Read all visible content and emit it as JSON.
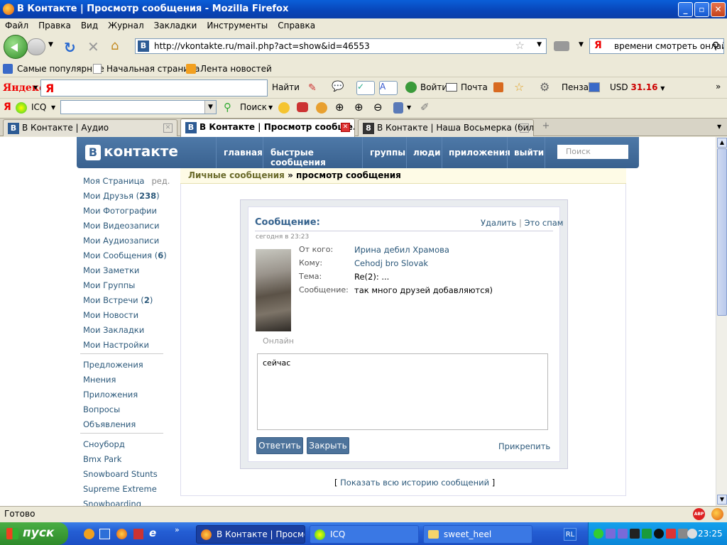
{
  "window": {
    "title": "В Контакте | Просмотр сообщения - Mozilla Firefox"
  },
  "menu": [
    "Файл",
    "Правка",
    "Вид",
    "Журнал",
    "Закладки",
    "Инструменты",
    "Справка"
  ],
  "url": "http://vkontakte.ru/mail.php?act=show&id=46553",
  "search_query": "времени смотреть онлайн",
  "bookmarks": [
    "Самые популярные",
    "Начальная страница",
    "Лента новостей"
  ],
  "yandex_bar": {
    "label": "Яндекс",
    "find": "Найти",
    "login": "Войти",
    "mail": "Почта",
    "city": "Пенза",
    "usd_label": "USD",
    "usd_value": "31.16"
  },
  "icq_bar": {
    "icq": "ICQ",
    "search": "Поиск"
  },
  "tabs": [
    {
      "title": "В Контакте | Аудио"
    },
    {
      "title": "В Контакте | Просмотр сообще..."
    },
    {
      "title": "В Контакте | Наша Восьмерка (билья..."
    }
  ],
  "vk": {
    "logo": "контакте",
    "nav": [
      "главная",
      "быстрые сообщения",
      "группы",
      "люди",
      "приложения",
      "выйти"
    ],
    "search_placeholder": "Поиск",
    "left_menu": {
      "my_page": "Моя Страница",
      "edit": "ред.",
      "friends": "Мои Друзья",
      "friends_count": "238",
      "photos": "Мои Фотографии",
      "videos": "Мои Видеозаписи",
      "audio": "Мои Аудиозаписи",
      "messages": "Мои Сообщения",
      "messages_count": "6",
      "notes": "Мои Заметки",
      "groups": "Мои Группы",
      "events": "Мои Встречи",
      "events_count": "2",
      "news": "Мои Новости",
      "bookmarks": "Мои Закладки",
      "settings": "Мои Настройки",
      "offers": "Предложения",
      "opinions": "Мнения",
      "apps": "Приложения",
      "questions": "Вопросы",
      "ads": "Объявления",
      "g1": "Сноуборд",
      "g2": "Bmx Park",
      "g3": "Snowboard Stunts",
      "g4": "Supreme Extreme",
      "g5": "Snowboarding"
    },
    "breadcrumb": {
      "link": "Личные сообщения",
      "sep": "»",
      "current": "просмотр сообщения"
    },
    "message": {
      "header": "Сообщение:",
      "delete": "Удалить",
      "divider": "|",
      "spam": "Это спам",
      "date": "сегодня в 23:23",
      "online": "Онлайн",
      "from_label": "От кого:",
      "from": "Ирина дебил Храмова",
      "to_label": "Кому:",
      "to": "Cehodj bro Slovak",
      "subject_label": "Тема:",
      "subject": "Re(2): ...",
      "body_label": "Сообщение:",
      "body": "так много друзей добавляются)",
      "reply_text": "сейчас",
      "reply_btn": "Ответить",
      "close_btn": "Закрыть",
      "attach": "Прикрепить",
      "history": "Показать всю историю сообщений"
    }
  },
  "status": "Готово",
  "taskbar": {
    "start": "пуск",
    "tasks": [
      "В Контакте | Просмо...",
      "ICQ",
      "sweet_heel"
    ],
    "lang": "RL",
    "clock": "23:25"
  }
}
